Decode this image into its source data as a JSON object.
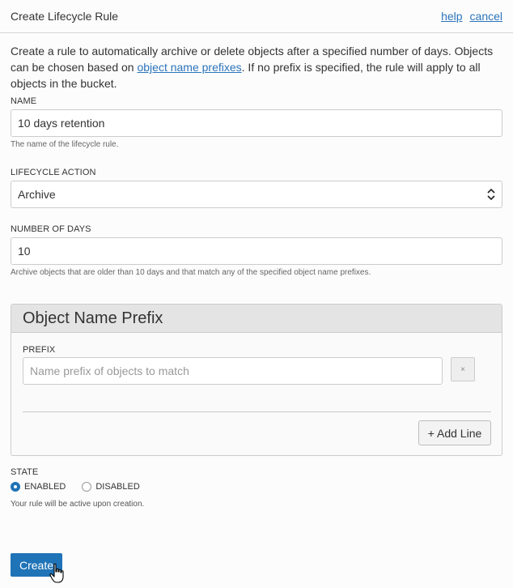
{
  "header": {
    "title": "Create Lifecycle Rule",
    "help": "help",
    "cancel": "cancel"
  },
  "intro": {
    "before": "Create a rule to automatically archive or delete objects after a specified number of days. Objects can be chosen based on ",
    "link": "object name prefixes",
    "after": ". If no prefix is specified, the rule will apply to all objects in the bucket."
  },
  "name_field": {
    "label": "NAME",
    "value": "10 days retention",
    "help": "The name of the lifecycle rule."
  },
  "action_field": {
    "label": "LIFECYCLE ACTION",
    "value": "Archive"
  },
  "days_field": {
    "label": "NUMBER OF DAYS",
    "value": "10",
    "help": "Archive objects that are older than 10 days and that match any of the specified object name prefixes."
  },
  "prefix_panel": {
    "title": "Object Name Prefix",
    "label": "PREFIX",
    "placeholder": "Name prefix of objects to match",
    "remove": "×",
    "add_line": "+ Add Line"
  },
  "state": {
    "label": "STATE",
    "options": [
      {
        "label": "ENABLED",
        "selected": true
      },
      {
        "label": "DISABLED",
        "selected": false
      }
    ],
    "help": "Your rule will be active upon creation."
  },
  "create_label": "Create",
  "colors": {
    "primary": "#1f73b7",
    "link": "#2b74bb",
    "panel_header": "#e4e4e4"
  }
}
